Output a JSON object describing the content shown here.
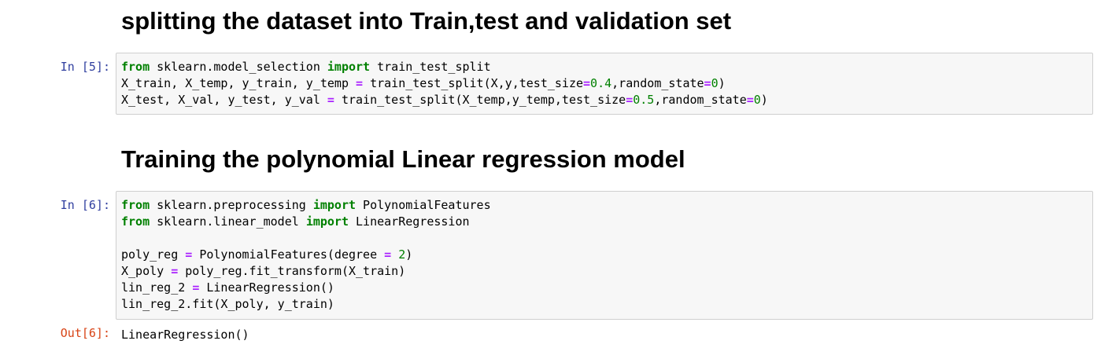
{
  "cells": [
    {
      "type": "markdown",
      "heading": "splitting the dataset into Train,test and validation set"
    },
    {
      "type": "code",
      "prompt": "In [5]:",
      "lines": [
        [
          {
            "t": "from",
            "c": "kw"
          },
          {
            "t": " sklearn.model_selection ",
            "c": ""
          },
          {
            "t": "import",
            "c": "kw"
          },
          {
            "t": " train_test_split",
            "c": ""
          }
        ],
        [
          {
            "t": "X_train, X_temp, y_train, y_temp ",
            "c": ""
          },
          {
            "t": "=",
            "c": "op"
          },
          {
            "t": " train_test_split(X,y,test_size",
            "c": ""
          },
          {
            "t": "=",
            "c": "op"
          },
          {
            "t": "0.4",
            "c": "num"
          },
          {
            "t": ",random_state",
            "c": ""
          },
          {
            "t": "=",
            "c": "op"
          },
          {
            "t": "0",
            "c": "num"
          },
          {
            "t": ")",
            "c": ""
          }
        ],
        [
          {
            "t": "X_test, X_val, y_test, y_val ",
            "c": ""
          },
          {
            "t": "=",
            "c": "op"
          },
          {
            "t": " train_test_split(X_temp,y_temp,test_size",
            "c": ""
          },
          {
            "t": "=",
            "c": "op"
          },
          {
            "t": "0.5",
            "c": "num"
          },
          {
            "t": ",random_state",
            "c": ""
          },
          {
            "t": "=",
            "c": "op"
          },
          {
            "t": "0",
            "c": "num"
          },
          {
            "t": ")",
            "c": ""
          }
        ]
      ]
    },
    {
      "type": "markdown",
      "heading": "Training the polynomial Linear regression model"
    },
    {
      "type": "code",
      "prompt": "In [6]:",
      "lines": [
        [
          {
            "t": "from",
            "c": "kw"
          },
          {
            "t": " sklearn.preprocessing ",
            "c": ""
          },
          {
            "t": "import",
            "c": "kw"
          },
          {
            "t": " PolynomialFeatures",
            "c": ""
          }
        ],
        [
          {
            "t": "from",
            "c": "kw"
          },
          {
            "t": " sklearn.linear_model ",
            "c": ""
          },
          {
            "t": "import",
            "c": "kw"
          },
          {
            "t": " LinearRegression",
            "c": ""
          }
        ],
        [],
        [
          {
            "t": "poly_reg ",
            "c": ""
          },
          {
            "t": "=",
            "c": "op"
          },
          {
            "t": " PolynomialFeatures(degree ",
            "c": ""
          },
          {
            "t": "=",
            "c": "op"
          },
          {
            "t": " ",
            "c": ""
          },
          {
            "t": "2",
            "c": "num"
          },
          {
            "t": ")",
            "c": ""
          }
        ],
        [
          {
            "t": "X_poly ",
            "c": ""
          },
          {
            "t": "=",
            "c": "op"
          },
          {
            "t": " poly_reg.fit_transform(X_train)",
            "c": ""
          }
        ],
        [
          {
            "t": "lin_reg_2 ",
            "c": ""
          },
          {
            "t": "=",
            "c": "op"
          },
          {
            "t": " LinearRegression()",
            "c": ""
          }
        ],
        [
          {
            "t": "lin_reg_2.fit(X_poly, y_train)",
            "c": ""
          }
        ]
      ],
      "output_prompt": "Out[6]:",
      "output": "LinearRegression()"
    }
  ],
  "colors": {
    "keyword": "#008000",
    "operator": "#aa22ff",
    "number": "#008000",
    "in_prompt": "#303f9f",
    "out_prompt": "#d84315",
    "cell_background": "#f7f7f7",
    "cell_border": "#cfcfcf"
  }
}
